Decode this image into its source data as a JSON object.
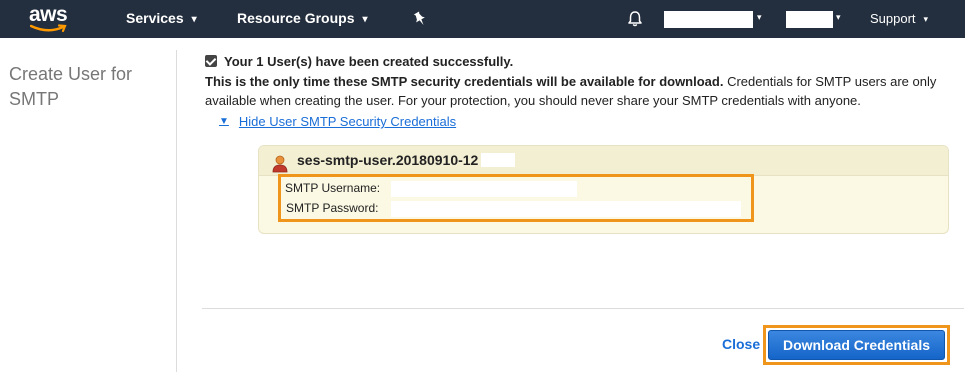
{
  "nav": {
    "logo_text": "aws",
    "services_label": "Services",
    "resource_groups_label": "Resource Groups",
    "support_label": "Support",
    "chevron": "▾",
    "icons": [
      "pin-icon",
      "bell-icon"
    ]
  },
  "sidebar": {
    "title": "Create User for SMTP"
  },
  "main": {
    "success_message": "Your 1 User(s) have been created successfully.",
    "info_bold": "This is the only time these SMTP security credentials will be available for download.",
    "info_text": " Credentials for SMTP users are only available when creating the user. For your protection, you should never share your SMTP credentials with anyone.",
    "toggle_label": "Hide User SMTP Security Credentials",
    "toggle_indicator": "▼"
  },
  "credentials": {
    "user_name": "ses-smtp-user.20180910-12",
    "username_label": "SMTP Username:",
    "password_label": "SMTP Password:",
    "username_value": "",
    "password_value": ""
  },
  "footer": {
    "close_label": "Close",
    "download_label": "Download Credentials"
  },
  "colors": {
    "nav_bg": "#232f3e",
    "link": "#1a6ed8",
    "highlight": "#f0951b",
    "panel_bg": "#fbf8e3",
    "button_bg": "#1565c9"
  }
}
